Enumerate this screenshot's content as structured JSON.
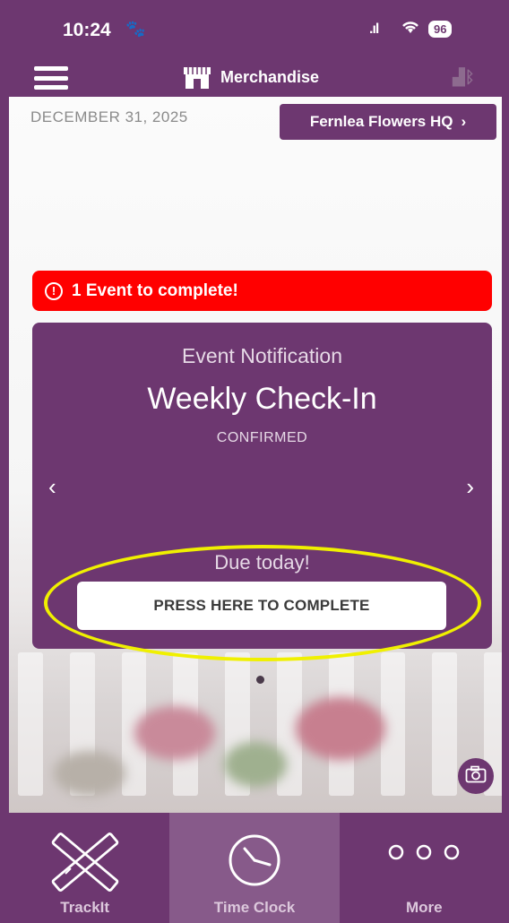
{
  "status_bar": {
    "time": "10:24",
    "battery": "96"
  },
  "header": {
    "title": "Merchandise"
  },
  "date": "DECEMBER 31, 2025",
  "location_button": "Fernlea Flowers HQ",
  "alert": {
    "text": "1 Event to complete!"
  },
  "event_card": {
    "subtitle": "Event Notification",
    "title": "Weekly Check-In",
    "status": "CONFIRMED",
    "due": "Due today!",
    "button": "PRESS HERE TO COMPLETE"
  },
  "tabs": [
    {
      "label": "TrackIt",
      "icon": "ruler-pencil-icon"
    },
    {
      "label": "Time Clock",
      "icon": "clock-icon",
      "active": true
    },
    {
      "label": "More",
      "icon": "more-dots-icon"
    }
  ],
  "colors": {
    "brand": "#6d3770",
    "alert": "#ff0000",
    "highlight": "#f0f000"
  }
}
